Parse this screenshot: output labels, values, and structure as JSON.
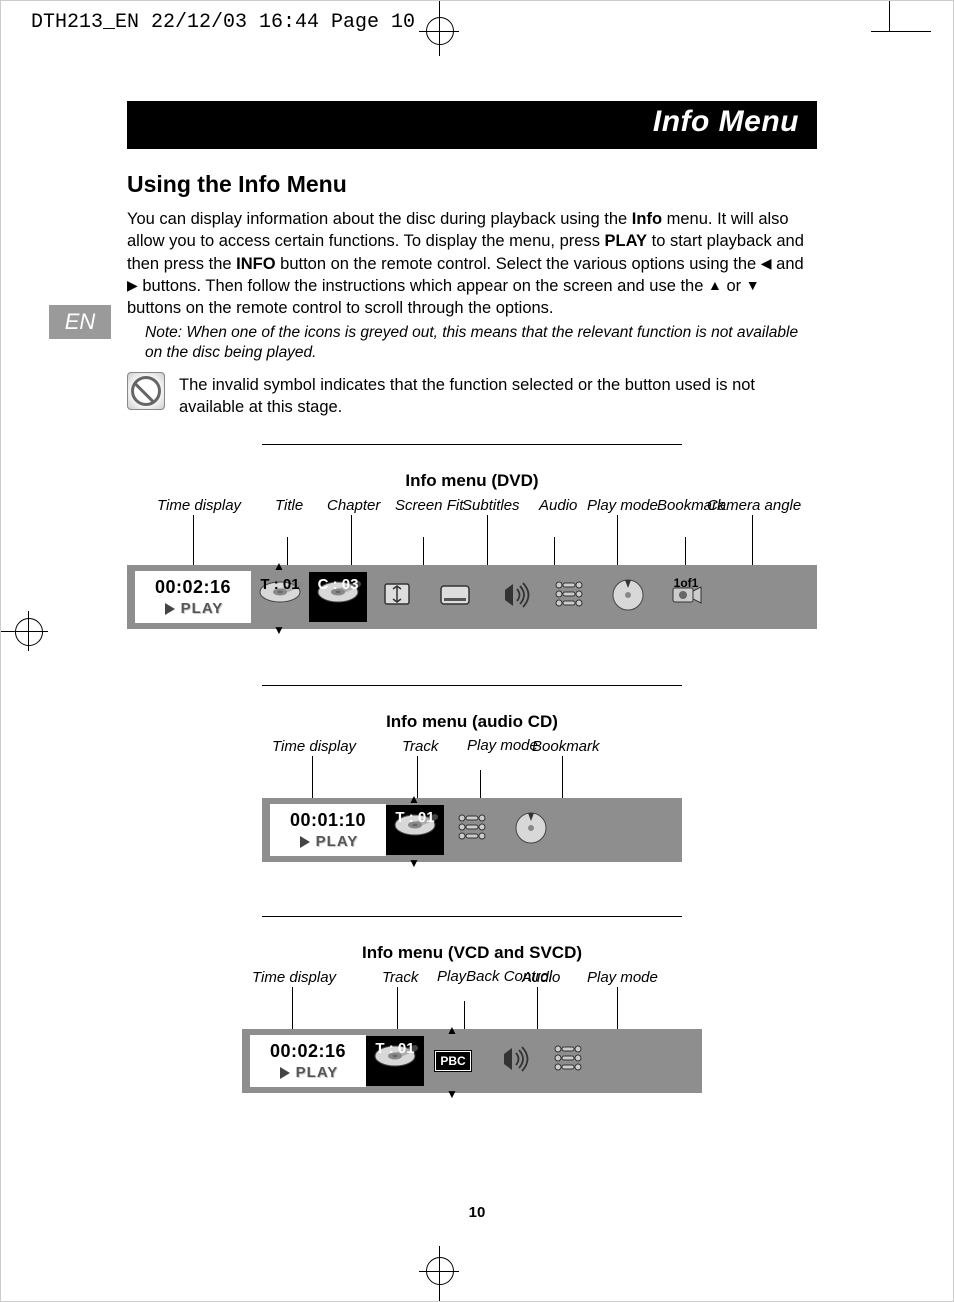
{
  "print_header": "DTH213_EN  22/12/03  16:44  Page 10",
  "banner": "Info Menu",
  "lang_tab": "EN",
  "section_title": "Using the Info Menu",
  "body_para": {
    "p1a": "You can display information about the disc during playback using the ",
    "p1b": "Info",
    "p1c": " menu. It will also allow you to access certain functions. To display the menu, press ",
    "p1d": "PLAY",
    "p1e": " to start playback and then press the ",
    "p1f": "INFO",
    "p1g": " button on the remote control. Select the various options using the ",
    "arrow_left": "◀",
    "p1h": " and ",
    "arrow_right": "▶",
    "p1i": " buttons. Then follow the instructions which appear on the screen and use the ",
    "arrow_up": "▲",
    "p1j": " or ",
    "arrow_down": "▼",
    "p1k": " buttons on the remote control to scroll through the options."
  },
  "note": "Note: When one of the icons is greyed out, this means that the relevant function is not available on the disc being played.",
  "invalid_text": "The invalid symbol indicates that the function selected or the button used is not available at this stage.",
  "dvd": {
    "title": "Info menu (DVD)",
    "labels": {
      "time": "Time display",
      "title": "Title",
      "chapter": "Chapter",
      "screenfit": "Screen Fit",
      "subtitles": "Subtitles",
      "audio": "Audio",
      "playmode": "Play mode",
      "bookmark": "Bookmark",
      "camera": "Camera angle"
    },
    "osd": {
      "time": "00:02:16",
      "play": "PLAY",
      "title_val": "T : 01",
      "chapter_val": "C : 03",
      "camera_val": "1of1"
    }
  },
  "cd": {
    "title": "Info menu (audio CD)",
    "labels": {
      "time": "Time display",
      "track": "Track",
      "playmode": "Play mode",
      "bookmark": "Bookmark"
    },
    "osd": {
      "time": "00:01:10",
      "play": "PLAY",
      "track_val": "T : 01"
    }
  },
  "vcd": {
    "title": "Info menu (VCD and SVCD)",
    "labels": {
      "time": "Time display",
      "track": "Track",
      "pbc": "PlayBack Control",
      "audio": "Audio",
      "playmode": "Play mode"
    },
    "osd": {
      "time": "00:02:16",
      "play": "PLAY",
      "track_val": "T : 01",
      "pbc_val": "PBC"
    }
  },
  "page_number": "10"
}
